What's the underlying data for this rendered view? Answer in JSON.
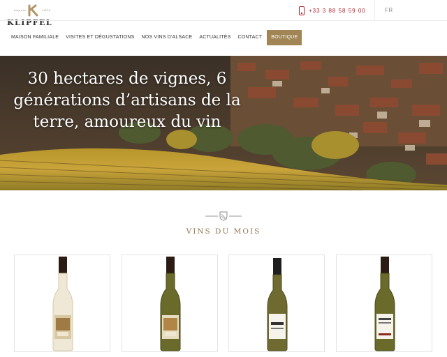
{
  "brand": {
    "name": "KLIPFEL",
    "tagline_left": "depuis",
    "tagline_right": "1824"
  },
  "topbar": {
    "phone": "+33 3 88 58 59 00",
    "language": "FR"
  },
  "nav": {
    "items": [
      {
        "label": "MAISON FAMILIALE"
      },
      {
        "label": "VISITES ET DÉGUSTATIONS"
      },
      {
        "label": "NOS VINS D'ALSACE"
      },
      {
        "label": "ACTUALITÉS"
      },
      {
        "label": "CONTACT"
      },
      {
        "label": "BOUTIQUE"
      }
    ]
  },
  "hero": {
    "title": "30 hectares de vignes, 6 générations d’artisans de la terre, amoureux du vin"
  },
  "section": {
    "title": "VINS DU MOIS"
  },
  "colors": {
    "accent": "#a18554",
    "phone": "#b4202a",
    "section_title": "#8c7550"
  }
}
